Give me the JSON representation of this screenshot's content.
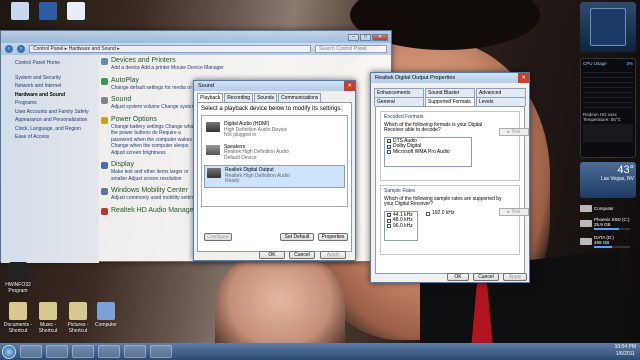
{
  "control_panel": {
    "address": "Control Panel ▸ Hardware and Sound ▸",
    "search_placeholder": "Search Control Panel",
    "sidebar": [
      "Control Panel Home",
      "System and Security",
      "Network and Internet",
      "Hardware and Sound",
      "Programs",
      "User Accounts and Family Safety",
      "Appearance and Personalization",
      "Clock, Language, and Region",
      "Ease of Access"
    ],
    "categories": [
      {
        "title": "Devices and Printers",
        "links": "Add a device   Add a printer   Mouse   Device Manager"
      },
      {
        "title": "AutoPlay",
        "links": "Change default settings for media or devices"
      },
      {
        "title": "Sound",
        "links": "Adjust system volume   Change system sounds"
      },
      {
        "title": "Power Options",
        "links": "Change battery settings   Change what the power buttons do   Require a password when the computer wakes   Change when the computer sleeps   Adjust screen brightness"
      },
      {
        "title": "Display",
        "links": "Make text and other items larger or smaller   Adjust screen resolution"
      },
      {
        "title": "Windows Mobility Center",
        "links": "Adjust commonly used mobility settings"
      },
      {
        "title": "Realtek HD Audio Manager",
        "links": ""
      }
    ]
  },
  "sound_dialog": {
    "title": "Sound",
    "tabs": [
      "Playback",
      "Recording",
      "Sounds",
      "Communications"
    ],
    "instruction": "Select a playback device below to modify its settings:",
    "devices": [
      {
        "name": "Digital Audio (HDMI)",
        "line1": "High Definition Audio Device",
        "line2": "Not plugged in"
      },
      {
        "name": "Speakers",
        "line1": "Realtek High Definition Audio",
        "line2": "Default Device"
      },
      {
        "name": "Realtek Digital Output",
        "line1": "Realtek High Definition Audio",
        "line2": "Ready"
      }
    ],
    "configure": "Configure",
    "set_default": "Set Default",
    "properties": "Properties",
    "ok": "OK",
    "cancel": "Cancel",
    "apply": "Apply"
  },
  "realtek_dialog": {
    "title": "Realtek Digital Output Properties",
    "tabs_top": [
      "Enhancements",
      "Sound Blaster",
      "Advanced"
    ],
    "tabs_bottom": [
      "General",
      "Supported Formats",
      "Levels"
    ],
    "encoded_title": "Encoded Formats",
    "encoded_desc": "Which of the following formats is your Digital Receiver able to decode?",
    "encoded": [
      "DTS Audio",
      "Dolby Digital",
      "Microsoft WMA Pro Audio"
    ],
    "test": "Test",
    "rates_title": "Sample Rates",
    "rates_desc": "Which of the following sample rates are supported by your Digital Receiver?",
    "rates": [
      "44.1 kHz",
      "48.0 kHz",
      "96.0 kHz",
      "192.0 kHz"
    ],
    "ok": "OK",
    "cancel": "Cancel",
    "apply": "Apply"
  },
  "gadgets": {
    "cpu_usage": "CPU Usage",
    "cpu_pct": "3%",
    "gpu": "Radeon HD xxxx",
    "temp": "Temperature: 56°C",
    "weather_temp": "43°",
    "weather_loc": "Las Vegas, NV",
    "computer": "Computer",
    "drives": [
      {
        "name": "Phoenix SSD (C:)",
        "free": "25.9 GB",
        "pct": 0.7
      },
      {
        "name": "DATA (D:)",
        "free": "469 GB",
        "pct": 0.5
      }
    ]
  },
  "desktop_icons": [
    "HWiNFO32 Program",
    "Documents - Shortcut",
    "Music - Shortcut",
    "Pictures - Shortcut",
    "Computer"
  ],
  "tray": {
    "time": "10:04 PM",
    "date": "1/6/2011"
  }
}
